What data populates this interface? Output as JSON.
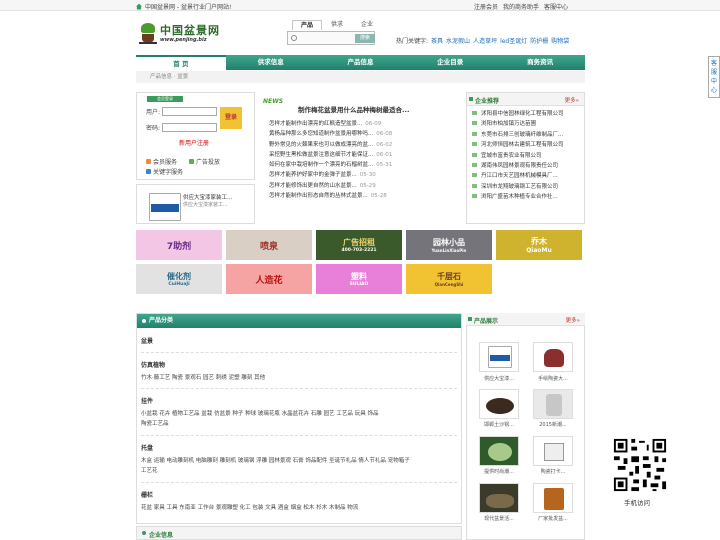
{
  "topbar": {
    "site": "中国盆景网 - 盆景行业门户网站!",
    "links": [
      "注册会员",
      "我的商务助手",
      "客服中心"
    ]
  },
  "logo": {
    "cn": "中国盆景网",
    "url": "www.penjing.biz"
  },
  "search": {
    "tabs": [
      "产品",
      "供求",
      "企业"
    ],
    "button": "搜索",
    "hot_label": "热门关键字:",
    "hot_keywords": [
      "茶具",
      "水泥假山",
      "人造草坪",
      "led圣诞灯",
      "防护栅",
      "购物袋"
    ]
  },
  "nav": [
    "首 页",
    "供求信息",
    "产品信息",
    "企业目录",
    "商务资讯"
  ],
  "breadcrumb": "产品信息 · 盆景",
  "login": {
    "badge": "会员登录",
    "user_label": "用户:",
    "pass_label": "密码:",
    "button": "登录",
    "register": "新用户注册",
    "services": [
      "会员服务",
      "广告投放",
      "关键字服务"
    ]
  },
  "mini_product": {
    "lines": [
      "供应大宝漆家装工...",
      "供应大宝漆家装工..."
    ]
  },
  "news": {
    "tag": "NEWS",
    "headline": "制作梅花盆景用什么品种梅树最适合...",
    "items": [
      {
        "title": "怎样才能制作出漂亮的红枫造型盆景...",
        "date": "06-09"
      },
      {
        "title": "黄杨品种那么多您知道制作盆景用哪种吗...",
        "date": "06-08"
      },
      {
        "title": "野外常见的火棘果来也可以做成漂亮的盆...",
        "date": "06-02"
      },
      {
        "title": "采挖野生黑松做盆景注意这细节才能保证...",
        "date": "06-01"
      },
      {
        "title": "如何在家中栽培制作一个漂亮的石榴树盆...",
        "date": "05-31"
      },
      {
        "title": "怎样才能养护好家中的金弹子盆景...",
        "date": "05-30"
      },
      {
        "title": "怎样才能修饰出更自然的山水盆景...",
        "date": "05-29"
      },
      {
        "title": "怎样才能制作出形态自然的丛林式盆景...",
        "date": "05-28"
      }
    ]
  },
  "recommend": {
    "title": "企业推荐",
    "more": "更多»",
    "items": [
      "沭阳县中信园林绿化工程有限公司",
      "浏阳市柏加镇万达苗圃",
      "东莞市石排三创玻璃纤维制品厂...",
      "河北师恒园林古建筑工程有限公司",
      "宜城市富贵农业有限公司",
      "湖南伟凤园林景观有限责任公司",
      "丹江口市天艺园林机械模具厂...",
      "深圳市龙翔玻璃钢工艺有限公司",
      "浏阳广盛苗木种植专业合作社..."
    ]
  },
  "ads": [
    {
      "text": "7助剂"
    },
    {
      "text": "喷泉"
    },
    {
      "text": "广告招租",
      "sub": "400-703-2221"
    },
    {
      "text": "园林小品",
      "sub": "YuanLinXiaoPin"
    },
    {
      "text": "乔木",
      "sub": "QiaoMu"
    },
    {
      "text": "催化剂",
      "sub": "CuiHuaJi"
    },
    {
      "text": "人造花"
    },
    {
      "text": "塑料",
      "sub": "SULIAO"
    },
    {
      "text": "千层石",
      "sub": "QianCengShi"
    }
  ],
  "categories": {
    "title": "产品分类",
    "groups": [
      {
        "name": "盆景",
        "links": []
      },
      {
        "name": "仿真植物",
        "links": [
          "竹木·藤工艺",
          "陶瓷",
          "景观石",
          "园艺",
          "刺绣",
          "泥塑",
          "雕刻",
          "其他"
        ]
      },
      {
        "name": "挂件",
        "links": [
          "小盆栽",
          "花卉",
          "植物工艺品",
          "盆栽",
          "仿盆景",
          "种子",
          "种球",
          "玻璃花瓶",
          "水晶盆花卉",
          "石雕",
          "园艺",
          "工艺品",
          "玩具",
          "饰品",
          "陶瓷工艺品"
        ]
      },
      {
        "name": "托盘",
        "links": [
          "木盒",
          "运输",
          "电动雕刻机",
          "电脑雕刻",
          "雕刻机",
          "玻璃钢",
          "浮雕",
          "园林景观",
          "石膏",
          "饰品配件",
          "圣诞节礼品",
          "情人节礼品",
          "宠物箱子",
          "工艺花"
        ]
      },
      {
        "name": "栅栏",
        "links": [
          "花盆",
          "家具",
          "工具",
          "东南亚",
          "工作台",
          "景观雕塑",
          "化工",
          "包装",
          "文具",
          "酒盒",
          "烟盒",
          "松木",
          "杉木",
          "木制品",
          "物流"
        ]
      }
    ]
  },
  "corp_bar": "企业信息",
  "gallery": {
    "title": "产品展示",
    "more": "更多»",
    "items": [
      "供应大宝漆...",
      "手绘陶瓷大...",
      "邯郸土沙锅...",
      "2015新潮...",
      "提供时尚潮...",
      "陶瓷打卡...",
      "现代盆景活...",
      "厂家批发盆..."
    ]
  },
  "side_service": "客服中心",
  "qr_label": "手机访问"
}
